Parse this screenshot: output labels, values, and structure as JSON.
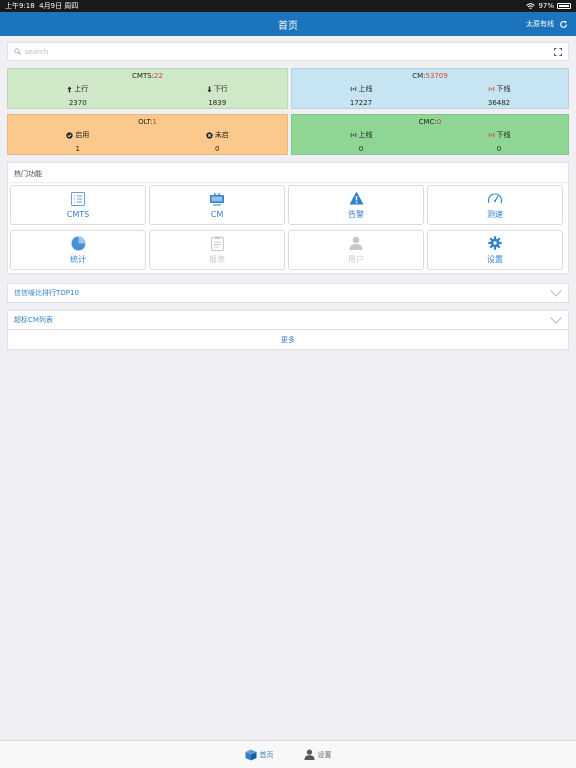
{
  "status_bar": {
    "time_date": "上午9:18  4月9日 周四",
    "battery": "97%"
  },
  "nav": {
    "title": "首页",
    "right_label": "太原有线"
  },
  "search": {
    "placeholder": "search"
  },
  "cards": {
    "cmts": {
      "name": "CMTS:",
      "count": "22",
      "up_label": "上行",
      "up_value": "2370",
      "down_label": "下行",
      "down_value": "1839",
      "bg": "#cfe8c8"
    },
    "cm": {
      "name": "CM:",
      "count": "53709",
      "online_label": "上线",
      "online_value": "17227",
      "offline_label": "下线",
      "offline_value": "36482",
      "bg": "#c6e4f2"
    },
    "olt": {
      "name": "OLT:",
      "count": "1",
      "enabled_label": "启用",
      "enabled_value": "1",
      "disabled_label": "未启",
      "disabled_value": "0",
      "bg": "#fac98b"
    },
    "cmc": {
      "name": "CMC:",
      "count": "0",
      "online_label": "上线",
      "online_value": "0",
      "offline_label": "下线",
      "offline_value": "0",
      "bg": "#8fd694"
    }
  },
  "hot_functions": {
    "title": "热门功能",
    "tiles": [
      {
        "label": "CMTS",
        "icon": "list-icon",
        "enabled": true
      },
      {
        "label": "CM",
        "icon": "monitor-icon",
        "enabled": true
      },
      {
        "label": "告警",
        "icon": "warning-icon",
        "enabled": true
      },
      {
        "label": "测速",
        "icon": "speedometer-icon",
        "enabled": true
      },
      {
        "label": "统计",
        "icon": "pie-chart-icon",
        "enabled": true
      },
      {
        "label": "报表",
        "icon": "clipboard-icon",
        "enabled": false
      },
      {
        "label": "用户",
        "icon": "user-icon",
        "enabled": false
      },
      {
        "label": "设置",
        "icon": "gear-icon",
        "enabled": true
      }
    ]
  },
  "sections": [
    {
      "label": "信信噪比排行TOP10"
    },
    {
      "label": "超标CM列表"
    }
  ],
  "more_label": "更多",
  "tabs": [
    {
      "label": "首页",
      "icon": "cube-icon",
      "active": true
    },
    {
      "label": "设置",
      "icon": "user-icon",
      "active": false
    }
  ],
  "colors": {
    "primary": "#1c75bc",
    "link": "#2f80c8",
    "alert": "#e53935"
  }
}
